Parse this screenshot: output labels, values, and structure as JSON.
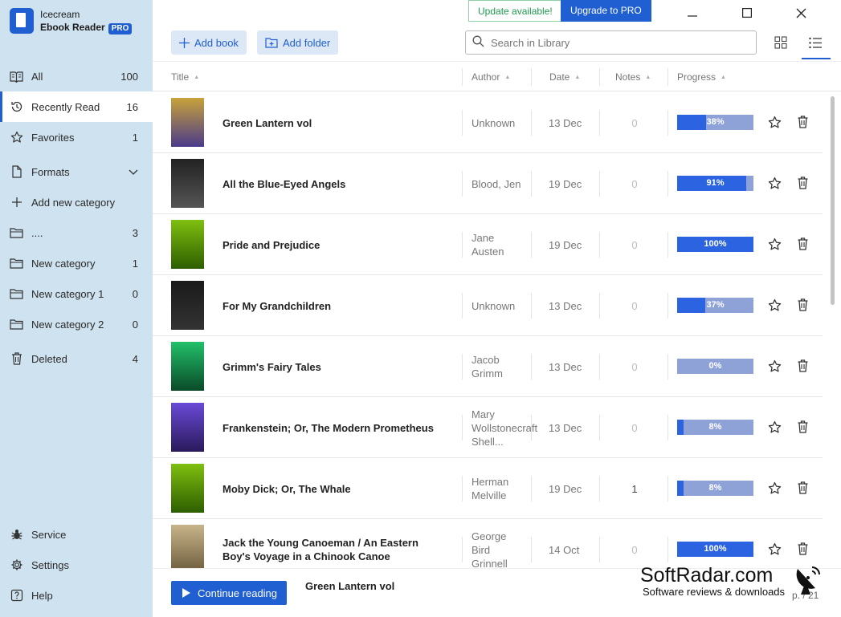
{
  "app": {
    "name_line1": "Icecream",
    "name_line2": "Ebook Reader",
    "badge": "PRO"
  },
  "top": {
    "update": "Update available!",
    "upgrade": "Upgrade to PRO",
    "add_book": "Add book",
    "add_folder": "Add folder",
    "search_placeholder": "Search in Library"
  },
  "sidebar": {
    "items": [
      {
        "label": "All",
        "count": "100",
        "icon": "book-open-icon"
      },
      {
        "label": "Recently Read",
        "count": "16",
        "icon": "history-icon"
      },
      {
        "label": "Favorites",
        "count": "1",
        "icon": "star-icon"
      },
      {
        "label": "Formats",
        "count": "",
        "icon": "file-icon"
      },
      {
        "label": "Add new category",
        "count": "",
        "icon": "plus-icon"
      },
      {
        "label": "....",
        "count": "3",
        "icon": "folder-icon"
      },
      {
        "label": "New category",
        "count": "1",
        "icon": "folder-icon"
      },
      {
        "label": "New category 1",
        "count": "0",
        "icon": "folder-icon"
      },
      {
        "label": "New category 2",
        "count": "0",
        "icon": "folder-icon"
      },
      {
        "label": "Deleted",
        "count": "4",
        "icon": "trash-icon"
      }
    ],
    "bottom": [
      {
        "label": "Service",
        "icon": "bug-icon"
      },
      {
        "label": "Settings",
        "icon": "gear-icon"
      },
      {
        "label": "Help",
        "icon": "help-icon"
      }
    ]
  },
  "table": {
    "columns": [
      "Title",
      "Author",
      "Date",
      "Notes",
      "Progress"
    ],
    "rows": [
      {
        "title": "Green Lantern vol",
        "author": "Unknown",
        "date": "13 Dec",
        "notes": "0",
        "progress": "38%",
        "p": 38,
        "cover": [
          "#c8a23a",
          "#4a3a8a"
        ]
      },
      {
        "title": "All the Blue-Eyed Angels",
        "author": "Blood, Jen",
        "date": "19 Dec",
        "notes": "0",
        "progress": "91%",
        "p": 91,
        "cover": [
          "#222222",
          "#555555"
        ]
      },
      {
        "title": "Pride and Prejudice",
        "author": "Jane Austen",
        "date": "19 Dec",
        "notes": "0",
        "progress": "100%",
        "p": 100,
        "cover": [
          "#7fbf10",
          "#2e5e00"
        ]
      },
      {
        "title": "For My Grandchildren",
        "author": "Unknown",
        "date": "13 Dec",
        "notes": "0",
        "progress": "37%",
        "p": 37,
        "cover": [
          "#1a1a1a",
          "#333333"
        ]
      },
      {
        "title": "Grimm's Fairy Tales",
        "author": "Jacob Grimm",
        "date": "13 Dec",
        "notes": "0",
        "progress": "0%",
        "p": 0,
        "cover": [
          "#22c06a",
          "#0a4a28"
        ]
      },
      {
        "title": "Frankenstein; Or, The Modern Prometheus",
        "author": "Mary Wollstonecraft Shell...",
        "date": "13 Dec",
        "notes": "0",
        "progress": "8%",
        "p": 8,
        "cover": [
          "#6a4ad8",
          "#2a1a5a"
        ]
      },
      {
        "title": "Moby Dick; Or, The Whale",
        "author": "Herman Melville",
        "date": "19 Dec",
        "notes": "1",
        "progress": "8%",
        "p": 8,
        "cover": [
          "#7fbf10",
          "#2e5e00"
        ]
      },
      {
        "title": "Jack the Young Canoeman / An Eastern Boy's Voyage in a Chinook Canoe",
        "author": "George Bird Grinnell",
        "date": "14 Oct",
        "notes": "0",
        "progress": "100%",
        "p": 100,
        "cover": [
          "#c8b48a",
          "#6a5a3a"
        ]
      }
    ]
  },
  "footer": {
    "continue": "Continue reading",
    "current": "Green Lantern vol",
    "pager": "p. / 21"
  },
  "watermark": {
    "title": "SoftRadar.com",
    "subtitle": "Software reviews & downloads"
  },
  "colors": {
    "accent": "#1f5fd1",
    "sidebar_bg": "#cfe2ef",
    "progress_fill": "#2b63e0",
    "progress_bg": "#8fa2d8"
  }
}
